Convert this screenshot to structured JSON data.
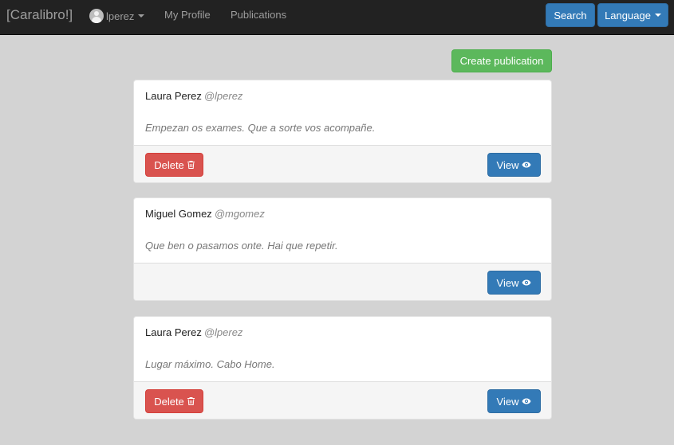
{
  "navbar": {
    "brand": "[Caralibro!]",
    "user": "lperez",
    "links": [
      "My Profile",
      "Publications"
    ],
    "search_label": "Search",
    "language_label": "Language"
  },
  "actions": {
    "create_label": "Create publication"
  },
  "publications": [
    {
      "author": "Laura Perez",
      "handle": "@lperez",
      "text": "Empezan os exames. Que a sorte vos acompañe.",
      "delete_label": "Delete",
      "view_label": "View",
      "can_delete": true
    },
    {
      "author": "Miguel Gomez",
      "handle": "@mgomez",
      "text": "Que ben o pasamos onte. Hai que repetir.",
      "view_label": "View",
      "can_delete": false
    },
    {
      "author": "Laura Perez",
      "handle": "@lperez",
      "text": "Lugar máximo. Cabo Home.",
      "delete_label": "Delete",
      "view_label": "View",
      "can_delete": true
    }
  ],
  "colors": {
    "navbar": "#222222",
    "primary": "#337ab7",
    "success": "#5cb85c",
    "danger": "#d9534f",
    "background": "#d3d3d3"
  },
  "icons": {
    "user": "user-avatar-icon",
    "delete": "trash-icon",
    "view": "eye-icon",
    "dropdown": "caret-down-icon"
  }
}
